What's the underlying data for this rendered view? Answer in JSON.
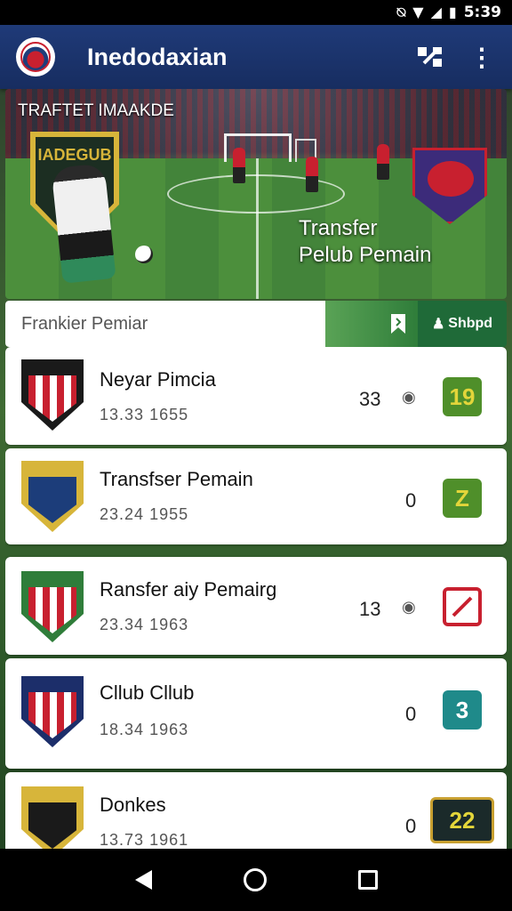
{
  "status_bar": {
    "time": "5:39",
    "icons": [
      "vibrate-icon",
      "wifi-icon",
      "signal-icon",
      "battery-icon"
    ]
  },
  "app_bar": {
    "title": "Inedodaxian",
    "logo": "club-logo",
    "actions": [
      "share-icon",
      "more-vert-icon"
    ]
  },
  "hero": {
    "label": "TRAFTET IMAAKDE",
    "badge_text": "IADEGUB",
    "caption_line1": "Transfer",
    "caption_line2": "Pelub Pemain"
  },
  "search": {
    "placeholder": "Frankier Pemiar",
    "filter_icon": "bookmark-icon",
    "shbpd_label": "Shbpd",
    "shbpd_icon": "person-icon"
  },
  "players": [
    {
      "name": "Neyar Pimcia",
      "sub_a": "13.33",
      "sub_b": "1655",
      "count": "33",
      "badge": "19",
      "badge_color": "#4f8f2a",
      "badge_text_color": "#e3d53a",
      "crest_primary": "#c8202f",
      "crest_secondary": "#1a1a1a"
    },
    {
      "name": "Transfser Pemain",
      "sub_a": "23.24",
      "sub_b": "1955",
      "count": "0",
      "badge": "Z",
      "badge_color": "#4f8f2a",
      "badge_text_color": "#e3d53a",
      "crest_primary": "#d7b53a",
      "crest_secondary": "#1c3d7a"
    },
    {
      "name": "Ransfer aiy Pemairg",
      "sub_a": "23.34",
      "sub_b": "1963",
      "count": "13",
      "badge": "",
      "badge_color": "#ffffff",
      "badge_text_color": "#c8202f",
      "crest_primary": "#c8202f",
      "crest_secondary": "#2f7d3a"
    },
    {
      "name": "Cllub Cllub",
      "sub_a": "18.34",
      "sub_b": "1963",
      "count": "0",
      "badge": "3",
      "badge_color": "#1f8a8a",
      "badge_text_color": "#ffffff",
      "crest_primary": "#c8202f",
      "crest_secondary": "#1c2e6a"
    },
    {
      "name": "Donkes",
      "sub_a": "13.73",
      "sub_b": "1961",
      "count": "0",
      "badge": "22",
      "badge_color": "#1b2a2a",
      "badge_text_color": "#e3d53a",
      "crest_primary": "#d7b53a",
      "crest_secondary": "#1a1a1a"
    }
  ],
  "nav": {
    "icons": [
      "back-icon",
      "home-icon",
      "recent-apps-icon"
    ]
  }
}
